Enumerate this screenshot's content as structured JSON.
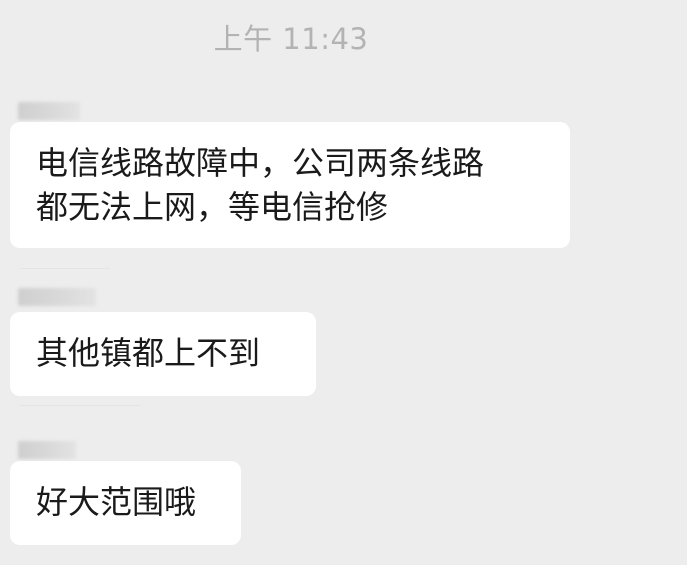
{
  "chat": {
    "timestamp": "上午 11:43",
    "messages": [
      {
        "lines": [
          "电信线路故障中，公司两条线路",
          "都无法上网，等电信抢修"
        ]
      },
      {
        "lines": [
          "其他镇都上不到"
        ]
      },
      {
        "lines": [
          "好大范围哦"
        ]
      }
    ]
  },
  "colors": {
    "background": "#ededed",
    "bubble": "#ffffff",
    "text": "#1a1a1a",
    "timestamp": "#b3b3b3"
  }
}
